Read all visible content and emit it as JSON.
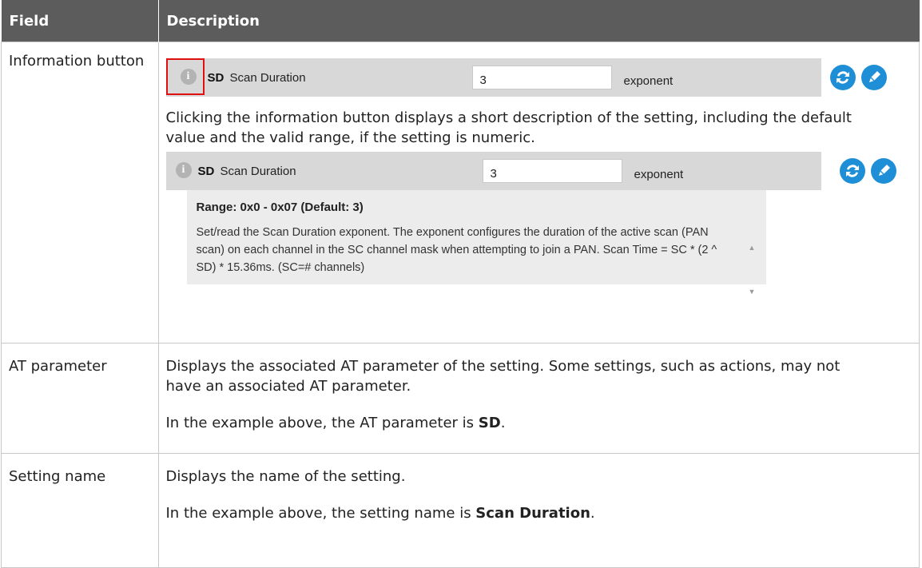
{
  "header": {
    "col_field": "Field",
    "col_description": "Description"
  },
  "rows": [
    {
      "field": "Information button",
      "setting_bar": {
        "code": "SD",
        "name": "Scan Duration",
        "value": "3",
        "unit": "exponent"
      },
      "description": "Clicking the information button displays a short description of the setting, including the default value and the valid range, if the setting is numeric.",
      "expanded_bar": {
        "code": "SD",
        "name": "Scan Duration",
        "value": "3",
        "unit": "exponent"
      },
      "help": {
        "range": "Range: 0x0 - 0x07 (Default: 3)",
        "text": "Set/read the Scan Duration exponent. The exponent configures the duration of the active scan (PAN scan) on each channel in the SC channel mask when attempting to join a PAN. Scan Time = SC * (2 ^ SD) * 15.36ms. (SC=# channels)"
      }
    },
    {
      "field": "AT parameter",
      "description": "Displays the associated AT parameter of the setting. Some settings, such as actions, may not have an associated AT parameter.",
      "example_prefix": "In the example above, the AT parameter is ",
      "example_bold": "SD",
      "example_suffix": "."
    },
    {
      "field": "Setting name",
      "description": "Displays the name of the setting.",
      "example_prefix": "In the example above, the setting name is ",
      "example_bold": "Scan Duration",
      "example_suffix": "."
    }
  ],
  "icons": {
    "info": "i",
    "refresh": "refresh-icon",
    "edit": "edit-icon"
  },
  "colors": {
    "header_bg": "#5c5c5c",
    "button_blue": "#1e8fd6",
    "highlight": "#e01010"
  }
}
